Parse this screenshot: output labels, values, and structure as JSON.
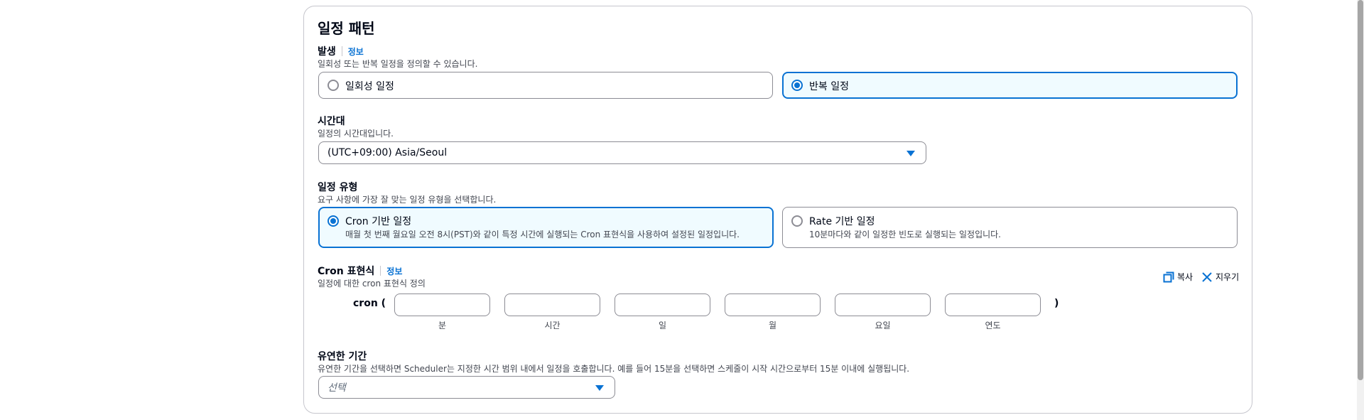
{
  "section": {
    "title": "일정 패턴"
  },
  "occurrence": {
    "label": "발생",
    "info": "정보",
    "description": "일회성 또는 반복 일정을 정의할 수 있습니다.",
    "options": [
      {
        "label": "일회성 일정",
        "selected": false
      },
      {
        "label": "반복 일정",
        "selected": true
      }
    ]
  },
  "timezone": {
    "label": "시간대",
    "description": "일정의 시간대입니다.",
    "value": "(UTC+09:00) Asia/Seoul"
  },
  "schedule_type": {
    "label": "일정 유형",
    "description": "요구 사항에 가장 잘 맞는 일정 유형을 선택합니다.",
    "options": [
      {
        "title": "Cron 기반 일정",
        "description": "매월 첫 번째 월요일 오전 8시(PST)와 같이 특정 시간에 실행되는 Cron 표현식을 사용하여 설정된 일정입니다.",
        "selected": true
      },
      {
        "title": "Rate 기반 일정",
        "description": "10분마다와 같이 일정한 빈도로 실행되는 일정입니다.",
        "selected": false
      }
    ]
  },
  "cron": {
    "label": "Cron 표현식",
    "info": "정보",
    "description": "일정에 대한 cron 표현식 정의",
    "copy_label": "복사",
    "clear_label": "지우기",
    "prefix": "cron (",
    "suffix": ")",
    "fields": [
      {
        "caption": "분",
        "value": ""
      },
      {
        "caption": "시간",
        "value": ""
      },
      {
        "caption": "일",
        "value": ""
      },
      {
        "caption": "월",
        "value": ""
      },
      {
        "caption": "요일",
        "value": ""
      },
      {
        "caption": "연도",
        "value": ""
      }
    ]
  },
  "flexible_window": {
    "label": "유연한 기간",
    "description": "유연한 기간을 선택하면 Scheduler는 지정한 시간 범위 내에서 일정을 호출합니다. 예를 들어 15분을 선택하면 스케줄이 시작 시간으로부터 15분 이내에 실행됩니다.",
    "placeholder": "선택"
  },
  "colors": {
    "accent": "#0972d3",
    "selected_bg": "#f0fbff",
    "border": "#8c8c94"
  }
}
